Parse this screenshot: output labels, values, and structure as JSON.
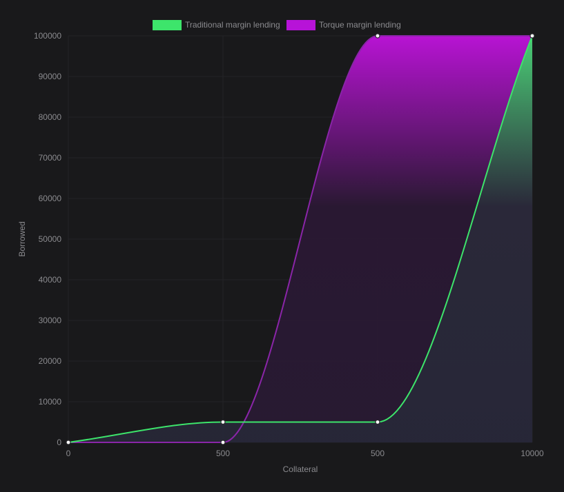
{
  "chart_data": {
    "type": "area",
    "x_categories": [
      "0",
      "500",
      "500",
      "10000"
    ],
    "series": [
      {
        "name": "Traditional margin lending",
        "color": "#3de56b",
        "values": [
          0,
          5000,
          5000,
          100000
        ]
      },
      {
        "name": "Torque margin lending",
        "color": "#b713d8",
        "values": [
          0,
          0,
          100000,
          100000
        ]
      }
    ],
    "xlabel": "Collateral",
    "ylabel": "Borrowed",
    "ylim": [
      0,
      100000
    ],
    "y_ticks": [
      0,
      10000,
      20000,
      30000,
      40000,
      50000,
      60000,
      70000,
      80000,
      90000,
      100000
    ],
    "legend_position": "top",
    "grid": true,
    "colors": {
      "background": "#19191b",
      "grid": "#242427",
      "text": "#8b8b8f",
      "point_fill": "#ffffff"
    }
  }
}
